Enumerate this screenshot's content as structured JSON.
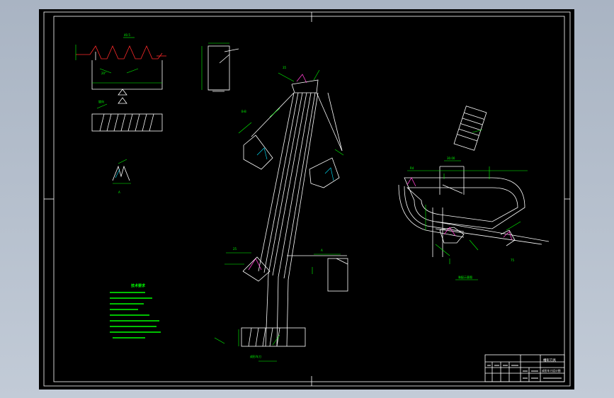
{
  "colors": {
    "window_bg": "#b8c2cf",
    "canvas_bg": "#000000",
    "line": "#ffffff",
    "dimension": "#00ff00",
    "hatch": "#00e5ff",
    "highlight": "#ff3fd0",
    "profile": "#ff2a2a"
  },
  "title_block": {
    "top_right": "槽形刀具",
    "bottom_right": "成形车刀设计图"
  },
  "tech_requirements": {
    "title": "技术要求"
  }
}
